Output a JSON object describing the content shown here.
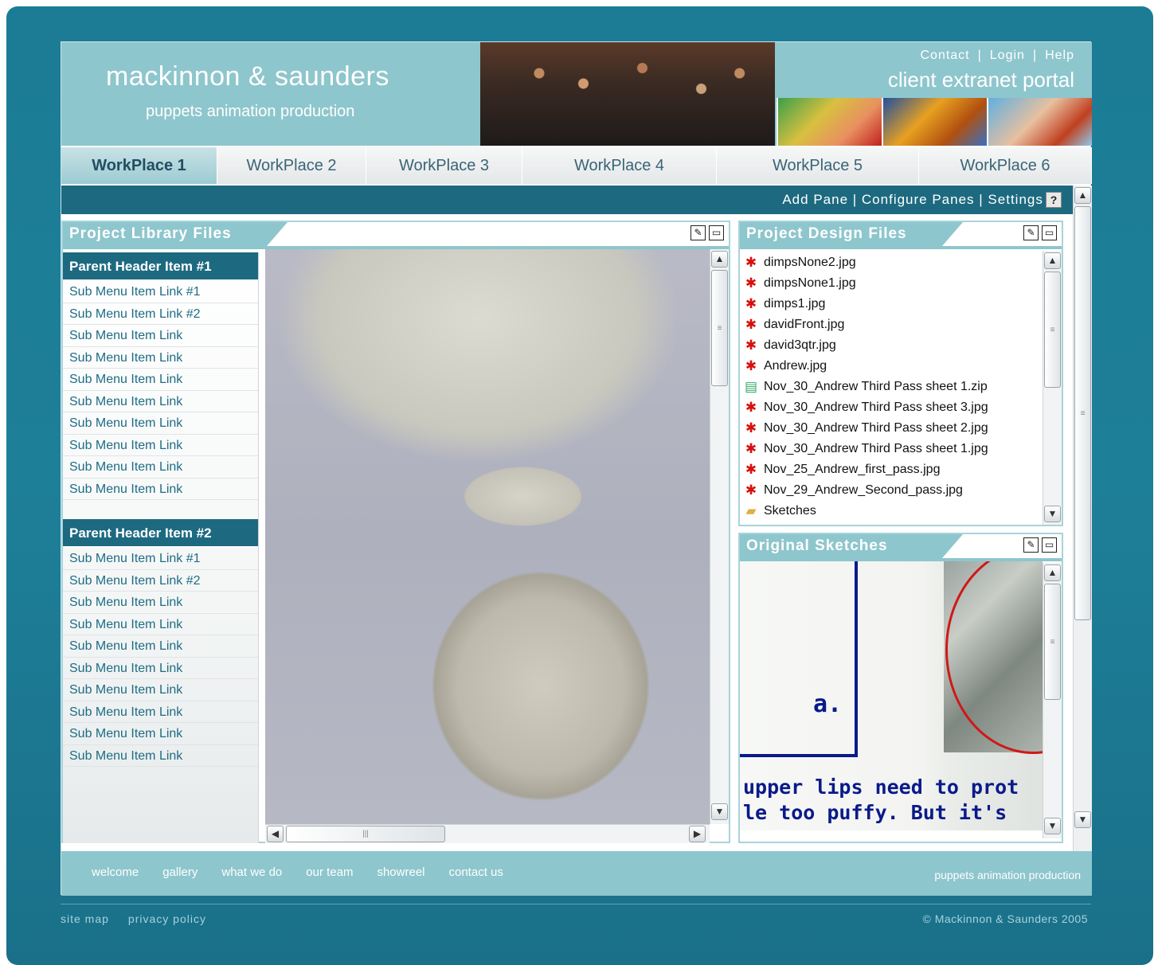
{
  "header": {
    "title": "mackinnon & saunders",
    "subtitle": "puppets animation production",
    "toplinks": [
      "Contact",
      "Login",
      "Help"
    ],
    "portal": "client extranet portal"
  },
  "tabs": [
    "WorkPlace 1",
    "WorkPlace 2",
    "WorkPlace 3",
    "WorkPlace 4",
    "WorkPlace 5",
    "WorkPlace 6"
  ],
  "active_tab": "WorkPlace 1",
  "toolbar": {
    "links": [
      "Add Pane",
      "Configure Panes",
      "Settings"
    ],
    "help": "?"
  },
  "library": {
    "title": "Project Library Files",
    "groups": [
      {
        "header": "Parent Header Item #1",
        "items": [
          "Sub Menu Item Link #1",
          "Sub Menu Item Link #2",
          "Sub Menu Item Link",
          "Sub Menu Item Link",
          "Sub Menu Item Link",
          "Sub Menu Item Link",
          "Sub Menu Item Link",
          "Sub Menu Item Link",
          "Sub Menu Item Link",
          "Sub Menu Item Link"
        ]
      },
      {
        "header": "Parent Header Item #2",
        "items": [
          "Sub Menu Item Link #1",
          "Sub Menu Item Link #2",
          "Sub Menu Item Link",
          "Sub Menu Item Link",
          "Sub Menu Item Link",
          "Sub Menu Item Link",
          "Sub Menu Item Link",
          "Sub Menu Item Link",
          "Sub Menu Item Link",
          "Sub Menu Item Link"
        ]
      }
    ]
  },
  "design": {
    "title": "Project Design Files",
    "files": [
      {
        "name": "dimpsNone2.jpg",
        "icon": "image-icon"
      },
      {
        "name": "dimpsNone1.jpg",
        "icon": "image-icon"
      },
      {
        "name": "dimps1.jpg",
        "icon": "image-icon"
      },
      {
        "name": "davidFront.jpg",
        "icon": "image-icon"
      },
      {
        "name": "david3qtr.jpg",
        "icon": "image-icon"
      },
      {
        "name": "Andrew.jpg",
        "icon": "image-icon"
      },
      {
        "name": "Nov_30_Andrew Third Pass sheet 1.zip",
        "icon": "zip-icon"
      },
      {
        "name": "Nov_30_Andrew Third Pass sheet 3.jpg",
        "icon": "image-icon"
      },
      {
        "name": "Nov_30_Andrew Third Pass sheet 2.jpg",
        "icon": "image-icon"
      },
      {
        "name": "Nov_30_Andrew Third Pass sheet 1.jpg",
        "icon": "image-icon"
      },
      {
        "name": "Nov_25_Andrew_first_pass.jpg",
        "icon": "image-icon"
      },
      {
        "name": "Nov_29_Andrew_Second_pass.jpg",
        "icon": "image-icon"
      },
      {
        "name": "Sketches",
        "icon": "folder-icon"
      }
    ]
  },
  "sketches": {
    "title": "Original Sketches",
    "letter": "a.",
    "text_line1": "upper lips need to prot",
    "text_line2": "le too puffy. But it's"
  },
  "footer": {
    "nav": [
      "welcome",
      "gallery",
      "what we do",
      "our team",
      "showreel",
      "contact us"
    ],
    "tagline": "puppets animation production",
    "links": [
      "site map",
      "privacy policy"
    ],
    "copyright": "© Mackinnon & Saunders 2005"
  },
  "colors": {
    "frame": "#1c7c96",
    "header": "#8ec6cd",
    "toolbar": "#1d6a80",
    "link": "#1e6c84"
  }
}
